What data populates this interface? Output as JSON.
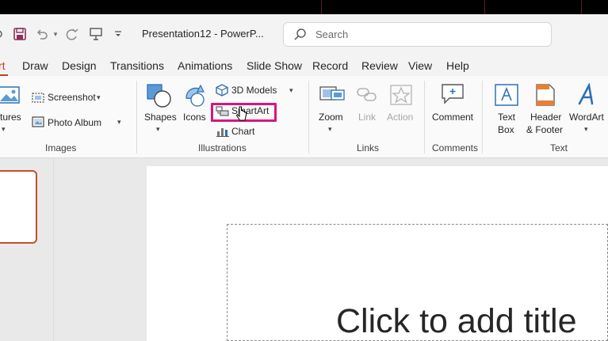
{
  "titlebar": {
    "doc_title": "Presentation12 - PowerP...",
    "search_placeholder": "Search"
  },
  "tabs": [
    {
      "label": "rt",
      "active": true
    },
    {
      "label": "Draw"
    },
    {
      "label": "Design"
    },
    {
      "label": "Transitions"
    },
    {
      "label": "Animations"
    },
    {
      "label": "Slide Show"
    },
    {
      "label": "Record"
    },
    {
      "label": "Review"
    },
    {
      "label": "View"
    },
    {
      "label": "Help"
    }
  ],
  "ribbon": {
    "images": {
      "pictures_label": "ctures",
      "screenshot_label": "Screenshot",
      "photo_album_label": "Photo Album",
      "group_label": "Images"
    },
    "illustrations": {
      "shapes_label": "Shapes",
      "icons_label": "Icons",
      "models_label": "3D Models",
      "smartart_label": "SmartArt",
      "chart_label": "Chart",
      "group_label": "Illustrations"
    },
    "links": {
      "zoom_label": "Zoom",
      "link_label": "Link",
      "action_label": "Action",
      "group_label": "Links"
    },
    "comments": {
      "comment_label": "Comment",
      "group_label": "Comments"
    },
    "text": {
      "textbox_line1": "Text",
      "textbox_line2": "Box",
      "header_line1": "Header",
      "header_line2": "& Footer",
      "wordart_label": "WordArt",
      "group_label": "Text"
    }
  },
  "slide": {
    "title_placeholder": "Click to add title"
  },
  "colors": {
    "accent": "#c43e1c",
    "highlight": "#d6177e",
    "icon_blue": "#2e6fb5"
  },
  "icons": [
    "save-icon",
    "undo-icon",
    "redo-icon",
    "present-icon",
    "customize-icon",
    "search-icon",
    "pictures-icon",
    "screenshot-icon",
    "photo-album-icon",
    "shapes-icon",
    "icons-icon",
    "3d-models-icon",
    "smartart-icon",
    "chart-icon",
    "zoom-icon",
    "link-icon",
    "action-icon",
    "comment-icon",
    "textbox-icon",
    "header-footer-icon",
    "wordart-icon"
  ]
}
